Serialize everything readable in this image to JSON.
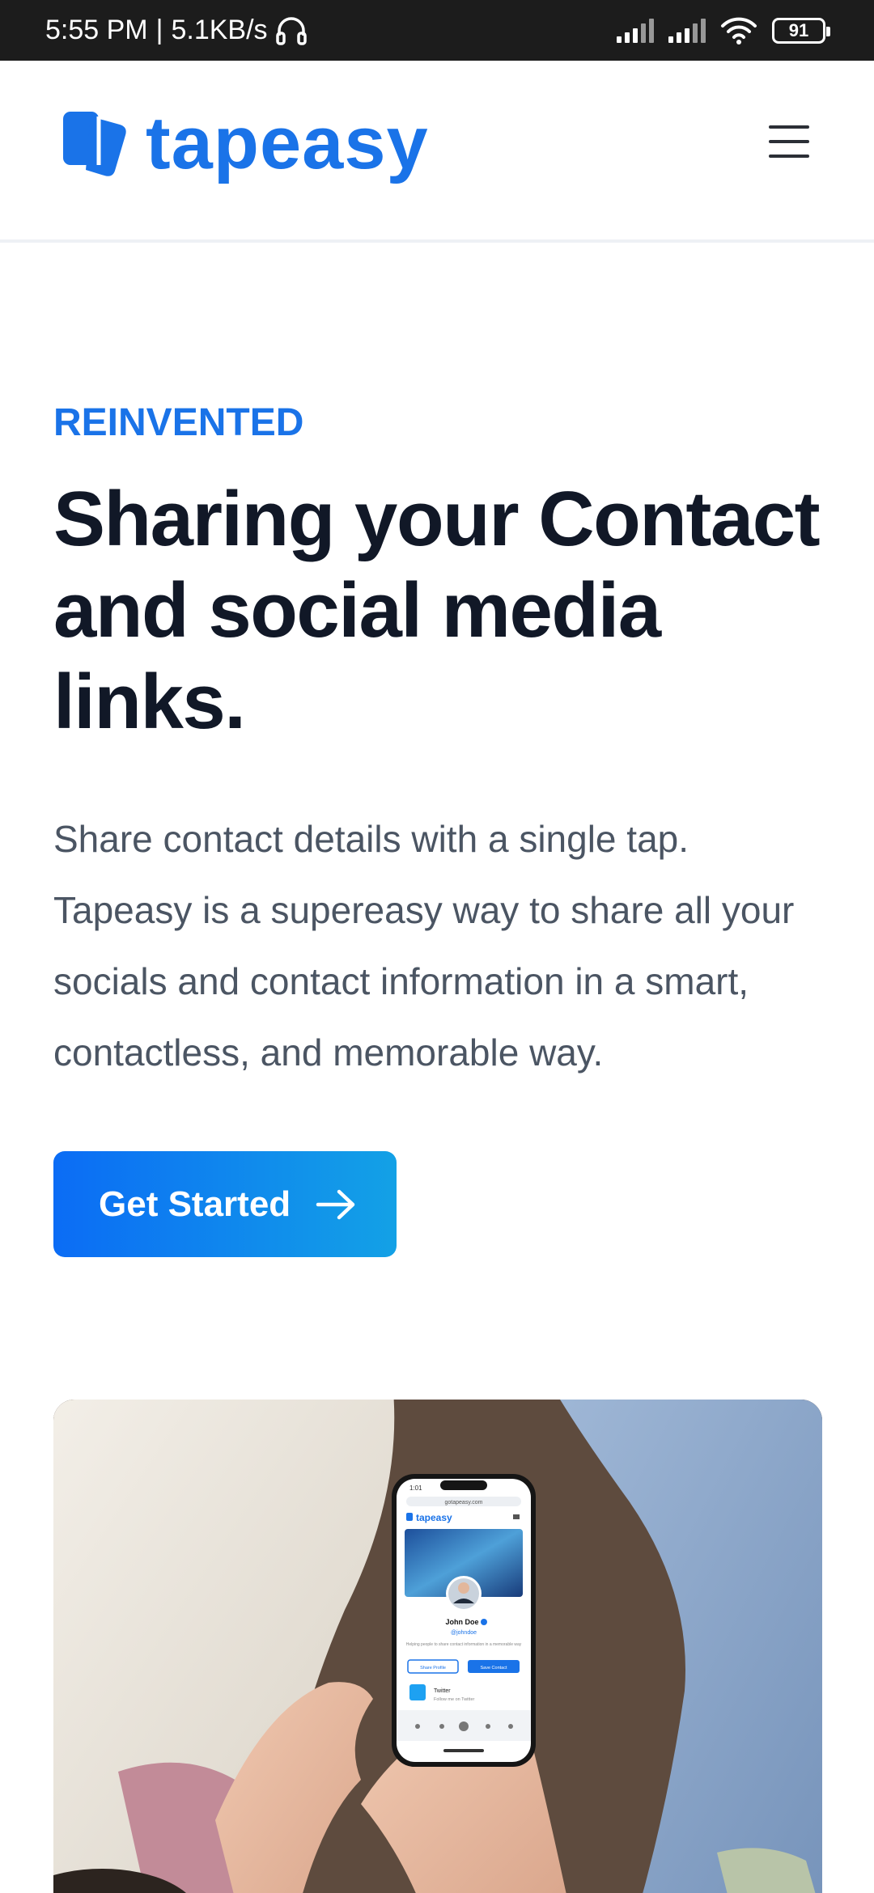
{
  "status_bar": {
    "time": "5:55 PM",
    "separator": "|",
    "speed": "5.1KB/s",
    "battery": "91"
  },
  "header": {
    "logo_text": "tapeasy",
    "menu_icon": "hamburger-icon"
  },
  "hero": {
    "eyebrow": "REINVENTED",
    "headline": "Sharing your Contact and social media links.",
    "lead": "Share contact details with a single tap. Tapeasy is a supereasy way to share all your socials and contact information in a smart, contactless, and memorable way.",
    "cta_label": "Get Started",
    "cta_icon": "arrow-right-icon"
  },
  "phone_screen": {
    "status_time": "1:01",
    "url": "gotapeasy.com",
    "brand": "tapeasy",
    "profile_name": "John Doe",
    "profile_handle": "@johndoe",
    "profile_bio": "Helping people to share contact information in a memorable way",
    "share_button": "Share Profile",
    "save_button": "Save Contact",
    "link_title": "Twitter",
    "link_subtitle": "Follow me on Twitter"
  },
  "colors": {
    "brand_blue": "#1a73e8",
    "headline": "#111827",
    "body_text": "#4b5563",
    "status_bar_bg": "#1c1c1c"
  }
}
